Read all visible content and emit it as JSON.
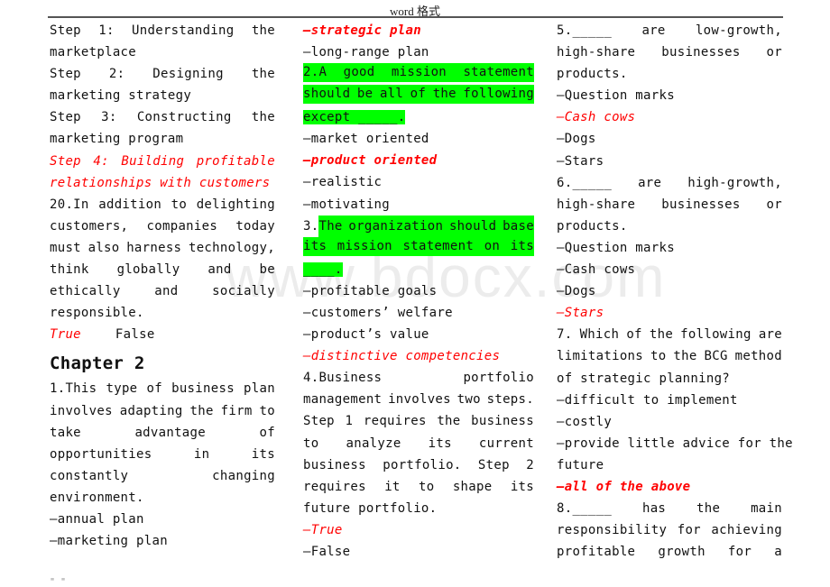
{
  "header": {
    "title": "word 格式"
  },
  "watermark": "www.bdocx.com",
  "footer": {
    "mark": "\" \""
  },
  "col1": {
    "steps": [
      [
        "Step",
        "1:",
        "Understanding",
        "the"
      ],
      "marketplace",
      [
        "Step",
        "2:",
        "Designing",
        "the"
      ],
      "marketing strategy",
      [
        "Step",
        "3:",
        "Constructing",
        "the"
      ],
      "marketing program"
    ],
    "step4_line1": [
      "Step",
      "4:",
      "Building",
      "profitable"
    ],
    "step4_line2": "relationships with customers",
    "q20": {
      "line1": [
        "20.In",
        "addition",
        "to",
        "delighting"
      ],
      "line2": [
        "customers,",
        "companies",
        "today"
      ],
      "line3": [
        "must",
        "also",
        "harness",
        "technology,"
      ],
      "line4": [
        "think",
        "globally",
        "and",
        "be"
      ],
      "line5": [
        "ethically",
        "and",
        "socially"
      ],
      "line6": "responsible.",
      "answer_true": "True",
      "answer_false": "False"
    },
    "chapter": "Chapter 2",
    "q1": {
      "line1": [
        "1.This",
        "type",
        "of",
        "business",
        "plan"
      ],
      "line2": [
        "involves",
        "adapting",
        "the",
        "firm",
        "to"
      ],
      "line3": [
        "take",
        "advantage",
        "of"
      ],
      "line4": [
        "opportunities",
        "in",
        "its"
      ],
      "line5": [
        "constantly",
        "changing"
      ],
      "line6": "environment.",
      "options": [
        "—annual plan",
        "—marketing plan"
      ]
    }
  },
  "col2": {
    "q1_opts": [
      {
        "text": "—strategic plan",
        "correct": true
      },
      {
        "text": "—long-range plan",
        "correct": false
      }
    ],
    "q2": {
      "line1": [
        "2.A",
        "good",
        "mission",
        "statement"
      ],
      "line2": [
        "should",
        "be",
        "all",
        "of",
        "the",
        "following"
      ],
      "line3": "except _____.",
      "options": [
        {
          "text": "—market oriented",
          "correct": false
        },
        {
          "text": "—product oriented",
          "correct": true
        },
        {
          "text": "—realistic",
          "correct": false
        },
        {
          "text": "—motivating",
          "correct": false
        }
      ]
    },
    "q3": {
      "num": "3.",
      "line1": [
        "The",
        "organization",
        "should",
        "base"
      ],
      "line2": [
        "its",
        "mission",
        "statement",
        "on",
        "its"
      ],
      "line3": "____.",
      "options": [
        {
          "text": "—profitable goals",
          "correct": false
        },
        {
          "text": "—customers’ welfare",
          "correct": false
        },
        {
          "text": "—product’s value",
          "correct": false
        },
        {
          "text": "—distinctive competencies",
          "correct": true
        }
      ]
    },
    "q4": {
      "line1": [
        "4.Business",
        "portfolio"
      ],
      "line2": [
        "management",
        "involves",
        "two",
        "steps."
      ],
      "line3": [
        "Step",
        "1",
        "requires",
        "the",
        "business"
      ],
      "line4": [
        "to",
        "analyze",
        "its",
        "current"
      ],
      "line5": [
        "business",
        "portfolio.",
        "Step",
        "2"
      ],
      "line6": [
        "requires",
        "it",
        "to",
        "shape",
        "its"
      ],
      "line7": "future portfolio.",
      "options": [
        {
          "text": "—True",
          "correct": true
        },
        {
          "text": "—False",
          "correct": false
        }
      ]
    }
  },
  "col3": {
    "q5": {
      "line1": [
        "5._____",
        "are",
        "low-growth,"
      ],
      "line2": [
        "high-share",
        "businesses",
        "or"
      ],
      "line3": "products.",
      "options": [
        {
          "text": "—Question marks",
          "correct": false
        },
        {
          "text": "—Cash cows",
          "correct": true
        },
        {
          "text": "—Dogs",
          "correct": false
        },
        {
          "text": "—Stars",
          "correct": false
        }
      ]
    },
    "q6": {
      "line1": [
        "6._____",
        "are",
        "high-growth,"
      ],
      "line2": [
        "high-share",
        "businesses",
        "or"
      ],
      "line3": "products.",
      "options": [
        {
          "text": "—Question marks",
          "correct": false
        },
        {
          "text": "—Cash cows",
          "correct": false
        },
        {
          "text": "—Dogs",
          "correct": false
        },
        {
          "text": "—Stars",
          "correct": true
        }
      ]
    },
    "q7": {
      "line1": [
        "7.",
        "Which",
        "of",
        "the",
        "following",
        "are"
      ],
      "line2": [
        "limitations",
        "to",
        "the",
        "BCG",
        "method"
      ],
      "line3": "of strategic planning?",
      "options": [
        {
          "text": "—difficult to implement",
          "correct": false
        },
        {
          "text": "—costly",
          "correct": false
        },
        {
          "text": "—provide little advice for the",
          "correct": false
        },
        {
          "text": "future",
          "correct": false
        },
        {
          "text": "—all of the above",
          "correct": true
        }
      ]
    },
    "q8": {
      "line1": [
        "8._____",
        "has",
        "the",
        "main"
      ],
      "line2": [
        "responsibility",
        "for",
        "achieving"
      ],
      "line3": [
        "profitable",
        "growth",
        "for",
        "a"
      ]
    }
  }
}
